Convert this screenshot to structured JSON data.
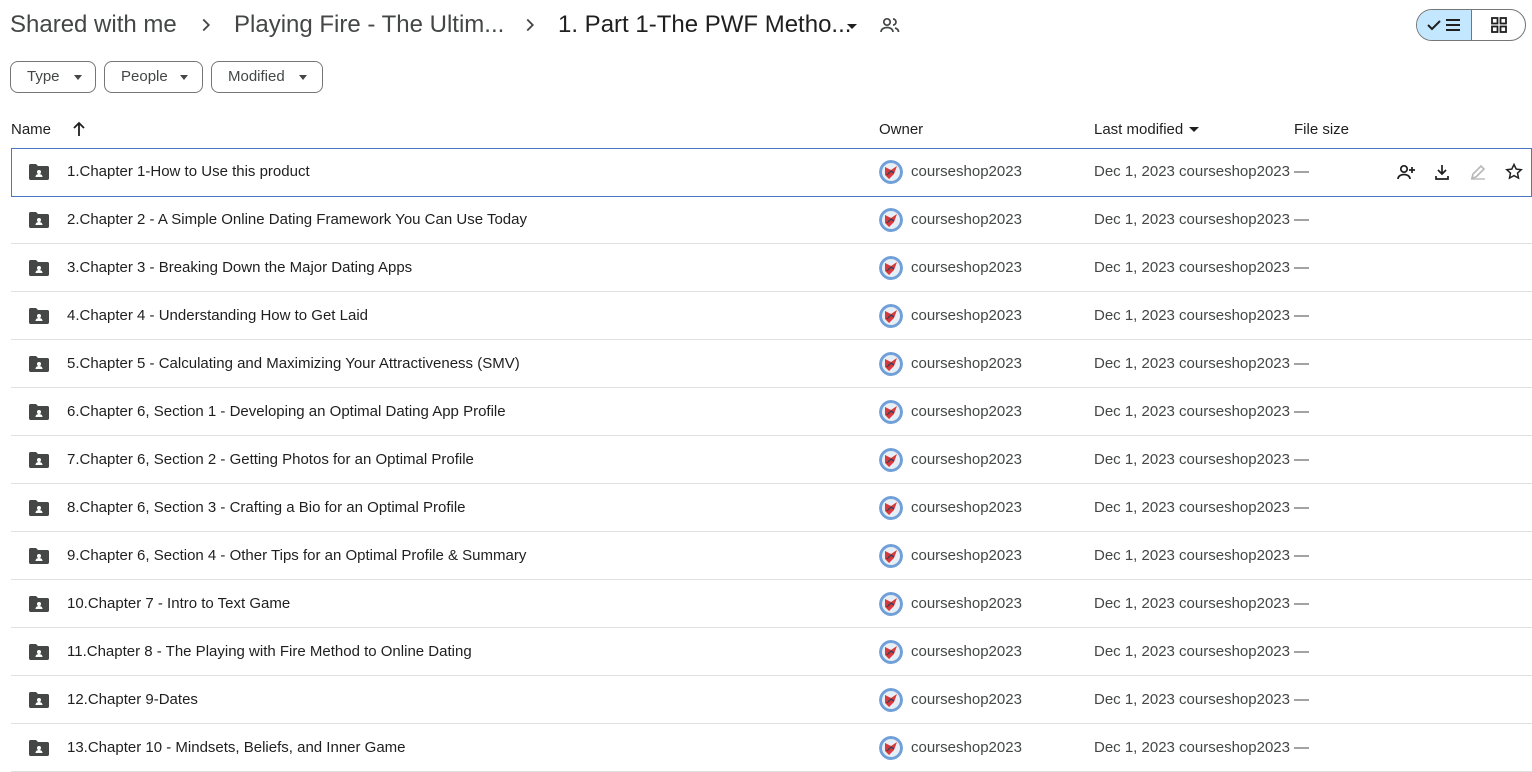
{
  "breadcrumb": {
    "items": [
      "Shared with me",
      "Playing Fire - The Ultim...",
      "1. Part 1-The PWF Metho..."
    ]
  },
  "filters": {
    "type": "Type",
    "people": "People",
    "modified": "Modified"
  },
  "columns": {
    "name": "Name",
    "owner": "Owner",
    "last_modified": "Last modified",
    "file_size": "File size"
  },
  "colors": {
    "accent": "#c2e7ff",
    "selected_border": "#4a78c2"
  },
  "rows": [
    {
      "name": "1.Chapter 1-How to Use this product",
      "owner": "courseshop2023",
      "modified": "Dec 1, 2023 courseshop2023",
      "size": "—"
    },
    {
      "name": "2.Chapter 2 - A Simple Online Dating Framework You Can Use Today",
      "owner": "courseshop2023",
      "modified": "Dec 1, 2023 courseshop2023",
      "size": "—"
    },
    {
      "name": "3.Chapter 3 - Breaking Down the Major Dating Apps",
      "owner": "courseshop2023",
      "modified": "Dec 1, 2023 courseshop2023",
      "size": "—"
    },
    {
      "name": "4.Chapter 4 - Understanding How to Get Laid",
      "owner": "courseshop2023",
      "modified": "Dec 1, 2023 courseshop2023",
      "size": "—"
    },
    {
      "name": "5.Chapter 5 - Calculating and Maximizing Your Attractiveness (SMV)",
      "owner": "courseshop2023",
      "modified": "Dec 1, 2023 courseshop2023",
      "size": "—"
    },
    {
      "name": "6.Chapter 6, Section 1 - Developing an Optimal Dating App Profile",
      "owner": "courseshop2023",
      "modified": "Dec 1, 2023 courseshop2023",
      "size": "—"
    },
    {
      "name": "7.Chapter 6, Section 2 - Getting Photos for an Optimal Profile",
      "owner": "courseshop2023",
      "modified": "Dec 1, 2023 courseshop2023",
      "size": "—"
    },
    {
      "name": "8.Chapter 6, Section 3 - Crafting a Bio for an Optimal Profile",
      "owner": "courseshop2023",
      "modified": "Dec 1, 2023 courseshop2023",
      "size": "—"
    },
    {
      "name": "9.Chapter 6, Section 4 - Other Tips for an Optimal Profile & Summary",
      "owner": "courseshop2023",
      "modified": "Dec 1, 2023 courseshop2023",
      "size": "—"
    },
    {
      "name": "10.Chapter 7 - Intro to Text Game",
      "owner": "courseshop2023",
      "modified": "Dec 1, 2023 courseshop2023",
      "size": "—"
    },
    {
      "name": "11.Chapter 8 - The Playing with Fire Method to Online Dating",
      "owner": "courseshop2023",
      "modified": "Dec 1, 2023 courseshop2023",
      "size": "—"
    },
    {
      "name": "12.Chapter 9-Dates",
      "owner": "courseshop2023",
      "modified": "Dec 1, 2023 courseshop2023",
      "size": "—"
    },
    {
      "name": "13.Chapter 10 - Mindsets, Beliefs, and Inner Game",
      "owner": "courseshop2023",
      "modified": "Dec 1, 2023 courseshop2023",
      "size": "—"
    }
  ]
}
